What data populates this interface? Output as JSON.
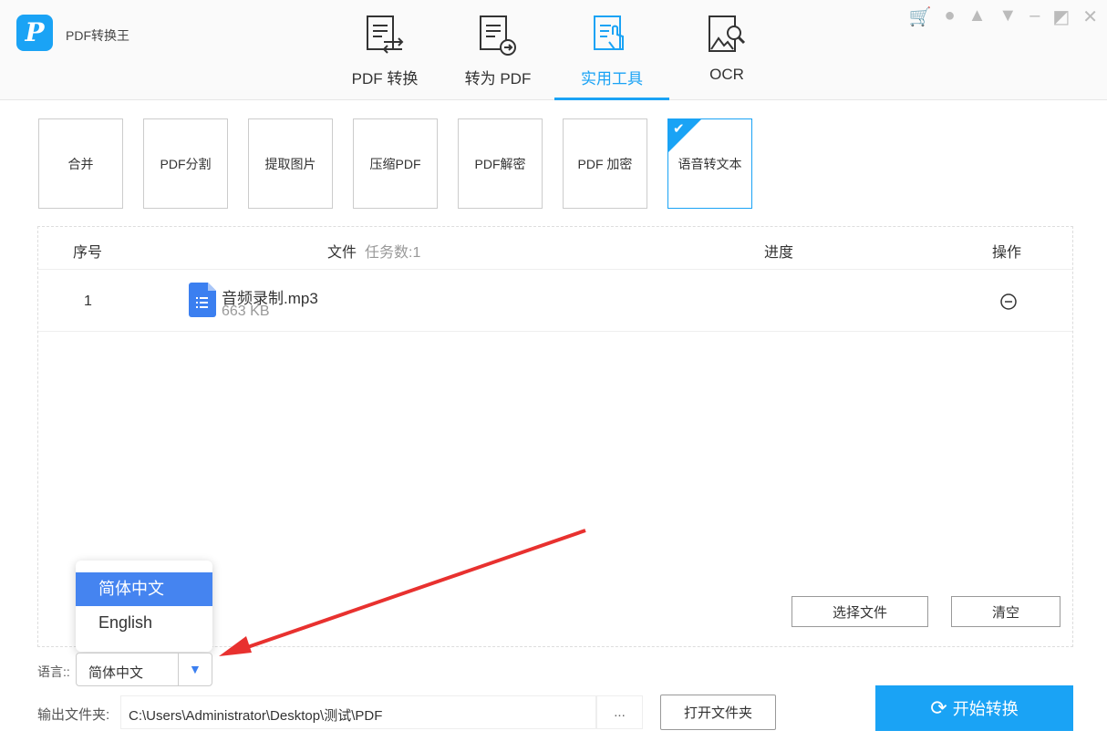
{
  "app": {
    "name": "PDF转换王",
    "logo_letter": "P"
  },
  "tabs": [
    {
      "label": "PDF 转换"
    },
    {
      "label": "转为 PDF"
    },
    {
      "label": "实用工具",
      "active": true
    },
    {
      "label": "OCR"
    }
  ],
  "window_icons": [
    "cart-icon",
    "user-icon",
    "bell-icon",
    "menu-icon",
    "minimize-icon",
    "restore-icon",
    "close-icon"
  ],
  "tools": [
    {
      "label": "合并"
    },
    {
      "label": "PDF分割"
    },
    {
      "label": "提取图片"
    },
    {
      "label": "压缩PDF"
    },
    {
      "label": "PDF解密"
    },
    {
      "label": "PDF 加密"
    },
    {
      "label": "语音转文本",
      "selected": true
    }
  ],
  "table": {
    "col_index": "序号",
    "col_file": "文件",
    "task_count": "任务数:1",
    "col_progress": "进度",
    "col_action": "操作",
    "rows": [
      {
        "index": "1",
        "name": "音频录制.mp3",
        "size": "663 KB"
      }
    ]
  },
  "buttons": {
    "select_file": "选择文件",
    "clear": "清空",
    "browse": "...",
    "open_folder": "打开文件夹",
    "start": "开始转换"
  },
  "language": {
    "label": "语言::",
    "value": "简体中文",
    "options": [
      "简体中文",
      "English"
    ]
  },
  "output": {
    "label": "输出文件夹:",
    "path": "C:\\Users\\Administrator\\Desktop\\测试\\PDF"
  },
  "colors": {
    "accent": "#1aa3f5",
    "highlight": "#4584f0",
    "arrow": "#e8312f"
  }
}
